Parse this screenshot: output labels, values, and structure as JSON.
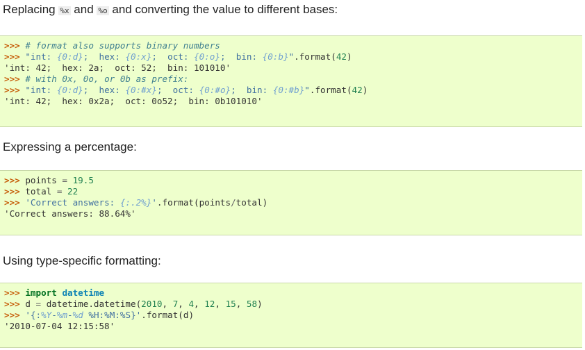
{
  "sections": [
    {
      "intro": {
        "before": "Replacing ",
        "code1": "%x",
        "middle": " and ",
        "code2": "%o",
        "after": " and converting the value to different bases:"
      },
      "lines": {
        "l1": {
          "prompt": ">>> ",
          "comment": "# format also supports binary numbers"
        },
        "l2": {
          "prompt": ">>> ",
          "str_a": "\"int: ",
          "f1": "{0:d}",
          "str_b": ";  hex: ",
          "f2": "{0:x}",
          "str_c": ";  oct: ",
          "f3": "{0:o}",
          "str_d": ";  bin: ",
          "f4": "{0:b}",
          "str_e": "\"",
          "call": ".format(",
          "num": "42",
          "close": ")"
        },
        "l3": {
          "output": "'int: 42;  hex: 2a;  oct: 52;  bin: 101010'"
        },
        "l4": {
          "prompt": ">>> ",
          "comment": "# with 0x, 0o, or 0b as prefix:"
        },
        "l5": {
          "prompt": ">>> ",
          "str_a": "\"int: ",
          "f1": "{0:d}",
          "str_b": ";  hex: ",
          "f2": "{0:#x}",
          "str_c": ";  oct: ",
          "f3": "{0:#o}",
          "str_d": ";  bin: ",
          "f4": "{0:#b}",
          "str_e": "\"",
          "call": ".format(",
          "num": "42",
          "close": ")"
        },
        "l6": {
          "output": "'int: 42;  hex: 0x2a;  oct: 0o52;  bin: 0b101010'"
        }
      }
    },
    {
      "intro": {
        "text": "Expressing a percentage:"
      },
      "lines": {
        "l1": {
          "prompt": ">>> ",
          "name": "points ",
          "op": "=",
          "num": " 19.5"
        },
        "l2": {
          "prompt": ">>> ",
          "name": "total ",
          "op": "=",
          "num": " 22"
        },
        "l3": {
          "prompt": ">>> ",
          "str_a": "'Correct answers: ",
          "f1": "{:.2%}",
          "str_b": "'",
          "call": ".format(points",
          "op": "/",
          "rest": "total)"
        },
        "l4": {
          "output": "'Correct answers: 88.64%'"
        }
      }
    },
    {
      "intro": {
        "text": "Using type-specific formatting:"
      },
      "lines": {
        "l1": {
          "prompt": ">>> ",
          "kw": "import",
          "sp": " ",
          "mod": "datetime"
        },
        "l2": {
          "prompt": ">>> ",
          "name": "d ",
          "op": "=",
          "call": " datetime.datetime(",
          "n1": "2010",
          "c1": ", ",
          "n2": "7",
          "c2": ", ",
          "n3": "4",
          "c3": ", ",
          "n4": "12",
          "c4": ", ",
          "n5": "15",
          "c5": ", ",
          "n6": "58",
          "close": ")"
        },
        "l3": {
          "prompt": ">>> ",
          "str_a": "'{:",
          "i1": "%Y",
          "d1": "-",
          "i2": "%m",
          "d2": "-",
          "i3": "%d",
          "sp": " ",
          "s1": "%H:",
          "s2": "%M:",
          "s3": "%S",
          "str_b": "}'",
          "call": ".format(d)"
        },
        "l4": {
          "output": "'2010-07-04 12:15:58'"
        }
      }
    }
  ]
}
